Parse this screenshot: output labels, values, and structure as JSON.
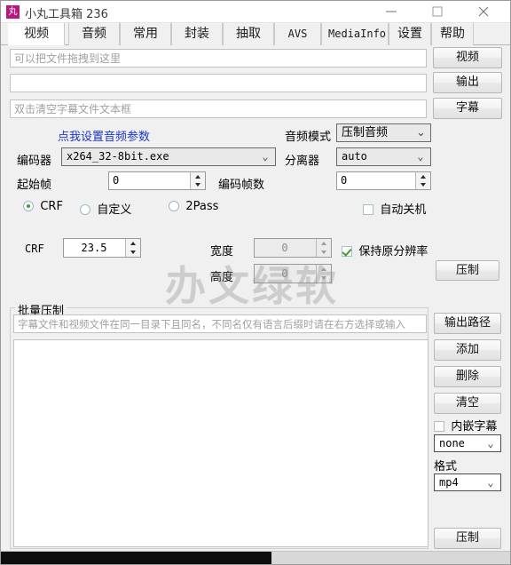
{
  "window": {
    "title": "小丸工具箱 236",
    "icon_char": "丸",
    "minimize_label": "minimize",
    "maximize_label": "maximize",
    "close_label": "close"
  },
  "tabs": [
    {
      "label": "视频",
      "active": true
    },
    {
      "label": "音频",
      "active": false
    },
    {
      "label": "常用",
      "active": false
    },
    {
      "label": "封装",
      "active": false
    },
    {
      "label": "抽取",
      "active": false
    },
    {
      "label": "AVS",
      "active": false
    },
    {
      "label": "MediaInfo",
      "active": false
    },
    {
      "label": "设置",
      "active": false
    },
    {
      "label": "帮助",
      "active": false
    }
  ],
  "video_tab": {
    "file_input": {
      "value": "",
      "placeholder": "可以把文件拖拽到这里"
    },
    "output_input": {
      "value": "",
      "placeholder": ""
    },
    "subtitle_input": {
      "value": "",
      "placeholder": "双击清空字幕文件文本框"
    },
    "video_button": "视频",
    "output_button": "输出",
    "subtitle_button": "字幕",
    "audio_param_link": "点我设置音频参数",
    "audio_mode_label": "音频模式",
    "audio_mode_value": "压制音频",
    "encoder_label": "编码器",
    "encoder_value": "x264_32-8bit.exe",
    "demuxer_label": "分离器",
    "demuxer_value": "auto",
    "start_frame_label": "起始帧",
    "start_frame_value": "0",
    "frame_count_label": "编码帧数",
    "frame_count_value": "0",
    "mode_crf": "CRF",
    "mode_custom": "自定义",
    "mode_2pass": "2Pass",
    "mode_selected": "CRF",
    "auto_shutdown_label": "自动关机",
    "auto_shutdown_checked": false,
    "crf_label": "CRF",
    "crf_value": "23.5",
    "width_label": "宽度",
    "width_value": "0",
    "height_label": "高度",
    "height_value": "0",
    "keep_resolution_label": "保持原分辨率",
    "keep_resolution_checked": true,
    "compress_button": "压制"
  },
  "batch": {
    "group_title": "批量压制",
    "path_input": {
      "value": "",
      "placeholder": "字幕文件和视频文件在同一目录下且同名，不同名仅有语言后缀时请在右方选择或输入"
    },
    "output_path_button": "输出路径",
    "add_button": "添加",
    "delete_button": "删除",
    "clear_button": "清空",
    "embed_subtitle_label": "内嵌字幕",
    "embed_subtitle_checked": false,
    "subtitle_select_value": "none",
    "format_label": "格式",
    "format_value": "mp4",
    "batch_compress_button": "压制",
    "list_items": []
  },
  "watermark": "办文绿软",
  "colors": {
    "accent_link": "#1b37c8",
    "icon_bg": "#b5197f",
    "check_green": "#3f9e2b",
    "radio_green": "#4a9c36"
  }
}
